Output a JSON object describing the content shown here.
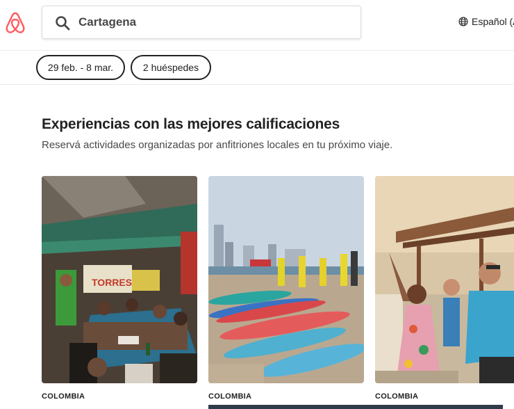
{
  "header": {
    "logo_icon": "airbnb-logo-icon",
    "search": {
      "value": "Cartagena",
      "icon": "search-icon"
    },
    "language": {
      "label": "Español (A",
      "icon": "globe-icon"
    }
  },
  "filters": {
    "dates": "29 feb. - 8 mar.",
    "guests": "2 huéspedes"
  },
  "section": {
    "title": "Experiencias con las mejores calificaciones",
    "subtitle": "Reservá actividades organizadas por anfitriones locales en tu próximo viaje."
  },
  "experiences": [
    {
      "country": "COLOMBIA"
    },
    {
      "country": "COLOMBIA"
    },
    {
      "country": "COLOMBIA"
    }
  ],
  "colors": {
    "brand": "#FF5A5F",
    "text": "#222222",
    "border": "#EBEBEB"
  }
}
